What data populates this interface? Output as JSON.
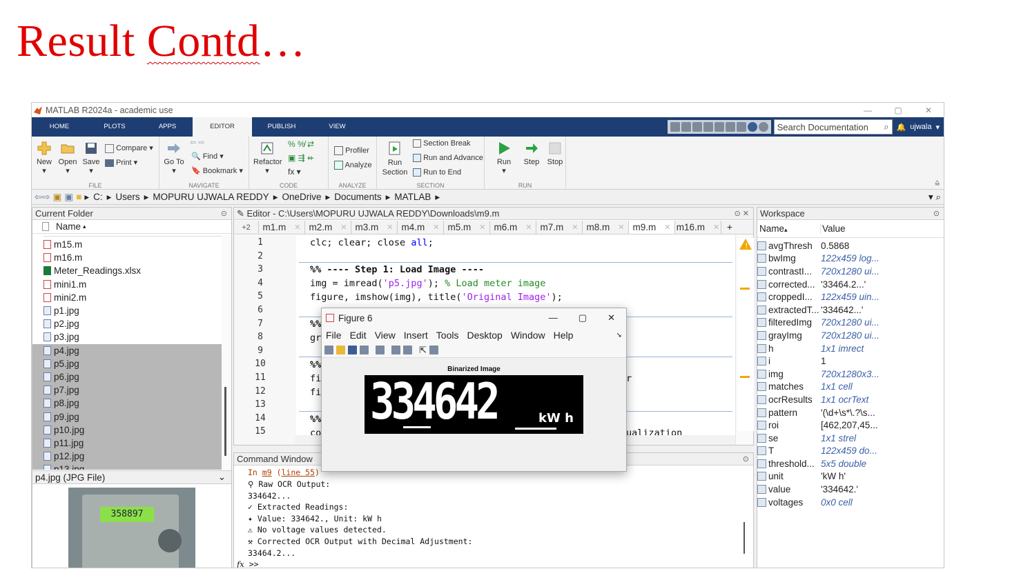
{
  "slide": {
    "title_part1": "Result ",
    "title_part2": "Contd",
    "title_part3": "…"
  },
  "window": {
    "title": "MATLAB R2024a - academic use",
    "min": "—",
    "max": "▢",
    "close": "✕"
  },
  "tabs": [
    {
      "label": "HOME"
    },
    {
      "label": "PLOTS"
    },
    {
      "label": "APPS"
    },
    {
      "label": "EDITOR"
    },
    {
      "label": "PUBLISH"
    },
    {
      "label": "VIEW"
    }
  ],
  "search": {
    "placeholder": "Search Documentation",
    "user": "ujwala"
  },
  "ribbon": {
    "file": {
      "new": "New",
      "open": "Open",
      "save": "Save",
      "compare": "Compare",
      "print": "Print",
      "label": "FILE"
    },
    "navigate": {
      "goto": "Go To",
      "find": "Find",
      "bookmark": "Bookmark",
      "label": "NAVIGATE"
    },
    "code": {
      "refactor": "Refactor",
      "label": "CODE"
    },
    "analyze": {
      "profiler": "Profiler",
      "analyze": "Analyze",
      "label": "ANALYZE"
    },
    "section": {
      "run_section": "Run Section",
      "section_break": "Section Break",
      "run_advance": "Run and Advance",
      "run_end": "Run to End",
      "label": "SECTION"
    },
    "run": {
      "run": "Run",
      "step": "Step",
      "stop": "Stop",
      "label": "RUN"
    }
  },
  "path": [
    "C:",
    "Users",
    "MOPURU UJWALA REDDY",
    "OneDrive",
    "Documents",
    "MATLAB"
  ],
  "current_folder": {
    "title": "Current Folder",
    "col": "Name",
    "items": [
      {
        "name": "m15.m",
        "type": "m"
      },
      {
        "name": "m16.m",
        "type": "m"
      },
      {
        "name": "Meter_Readings.xlsx",
        "type": "x"
      },
      {
        "name": "mini1.m",
        "type": "m"
      },
      {
        "name": "mini2.m",
        "type": "m"
      },
      {
        "name": "p1.jpg",
        "type": "j"
      },
      {
        "name": "p2.jpg",
        "type": "j"
      },
      {
        "name": "p3.jpg",
        "type": "j"
      },
      {
        "name": "p4.jpg",
        "type": "j",
        "sel": true
      },
      {
        "name": "p5.jpg",
        "type": "j",
        "sel": true
      },
      {
        "name": "p6.jpg",
        "type": "j",
        "sel": true
      },
      {
        "name": "p7.jpg",
        "type": "j",
        "sel": true
      },
      {
        "name": "p8.jpg",
        "type": "j",
        "sel": true
      },
      {
        "name": "p9.jpg",
        "type": "j",
        "sel": true
      },
      {
        "name": "p10.jpg",
        "type": "j",
        "sel": true
      },
      {
        "name": "p11.jpg",
        "type": "j",
        "sel": true
      },
      {
        "name": "p12.jpg",
        "type": "j",
        "sel": true
      },
      {
        "name": "p13.jpg",
        "type": "j",
        "sel": true
      }
    ],
    "details": "p4.jpg  (JPG File)",
    "preview_reading": "358897"
  },
  "editor": {
    "title": "Editor - C:\\Users\\MOPURU UJWALA REDDY\\Downloads\\m9.m",
    "tab_count": "+2",
    "tabs": [
      "m1.m",
      "m2.m",
      "m3.m",
      "m4.m",
      "m5.m",
      "m6.m",
      "m7.m",
      "m8.m",
      "m9.m",
      "m16.m"
    ],
    "active_tab": "m9.m",
    "lines": [
      "1",
      "2",
      "3",
      "4",
      "5",
      "6",
      "7",
      "8",
      "9",
      "10",
      "11",
      "12",
      "13",
      "14",
      "15"
    ],
    "code": {
      "l1a": "clc; clear; close ",
      "l1b": "all",
      "l1c": ";",
      "l3": "%% ---- Step 1: Load Image ----",
      "l4a": "img = imread(",
      "l4b": "'p5.jpg'",
      "l4c": "); ",
      "l4d": "% Load meter image",
      "l5a": "figure, imshow(img), title(",
      "l5b": "'Original Image'",
      "l5c": ");",
      "l7": "%%",
      "l8": "gr",
      "l10": "%%",
      "l11": "fi",
      "l11r": "r",
      "l12": "fi",
      "l14": "%%",
      "l15": "co",
      "l15r": "ualization"
    }
  },
  "figure": {
    "title": "Figure 6",
    "menu": [
      "File",
      "Edit",
      "View",
      "Insert",
      "Tools",
      "Desktop",
      "Window",
      "Help"
    ],
    "image_title": "Binarized Image",
    "reading": "334642",
    "unit": "kW h"
  },
  "command_window": {
    "title": "Command Window",
    "lines": [
      "In m9 (line 55)",
      "Raw OCR Output:",
      "334642...",
      "Extracted Readings:",
      "Value: 334642., Unit: kW h",
      "No voltage values detected.",
      "Corrected OCR Output with Decimal Adjustment:",
      "33464.2..."
    ],
    "line0_a": "In ",
    "line0_b": "m9",
    "line0_c": " (",
    "line0_d": "line 55",
    "line0_e": ")",
    "prompt": ">>"
  },
  "workspace": {
    "title": "Workspace",
    "col_name": "Name",
    "col_value": "Value",
    "vars": [
      {
        "name": "avgThresh",
        "value": "0.5868",
        "it": false
      },
      {
        "name": "bwImg",
        "value": "122x459 log...",
        "it": true
      },
      {
        "name": "contrastI...",
        "value": "720x1280 ui...",
        "it": true
      },
      {
        "name": "corrected...",
        "value": "'33464.2...'",
        "it": false
      },
      {
        "name": "croppedI...",
        "value": "122x459 uin...",
        "it": true
      },
      {
        "name": "extractedT...",
        "value": "'334642...'",
        "it": false
      },
      {
        "name": "filteredImg",
        "value": "720x1280 ui...",
        "it": true
      },
      {
        "name": "grayImg",
        "value": "720x1280 ui...",
        "it": true
      },
      {
        "name": "h",
        "value": "1x1 imrect",
        "it": true
      },
      {
        "name": "i",
        "value": "1",
        "it": false
      },
      {
        "name": "img",
        "value": "720x1280x3...",
        "it": true
      },
      {
        "name": "matches",
        "value": "1x1 cell",
        "it": true
      },
      {
        "name": "ocrResults",
        "value": "1x1 ocrText",
        "it": true
      },
      {
        "name": "pattern",
        "value": "'(\\d+\\s*\\.?\\s...",
        "it": false
      },
      {
        "name": "roi",
        "value": "[462,207,45...",
        "it": false
      },
      {
        "name": "se",
        "value": "1x1 strel",
        "it": true
      },
      {
        "name": "T",
        "value": "122x459 do...",
        "it": true
      },
      {
        "name": "threshold...",
        "value": "5x5 double",
        "it": true
      },
      {
        "name": "unit",
        "value": "'kW h'",
        "it": false
      },
      {
        "name": "value",
        "value": "'334642.'",
        "it": false
      },
      {
        "name": "voltages",
        "value": "0x0 cell",
        "it": true
      }
    ]
  },
  "colors": {
    "title_red": "#e00000",
    "tab_blue": "#1e3e73",
    "keyword": "#0000ff",
    "string": "#a020f0",
    "comment": "#228b22"
  }
}
